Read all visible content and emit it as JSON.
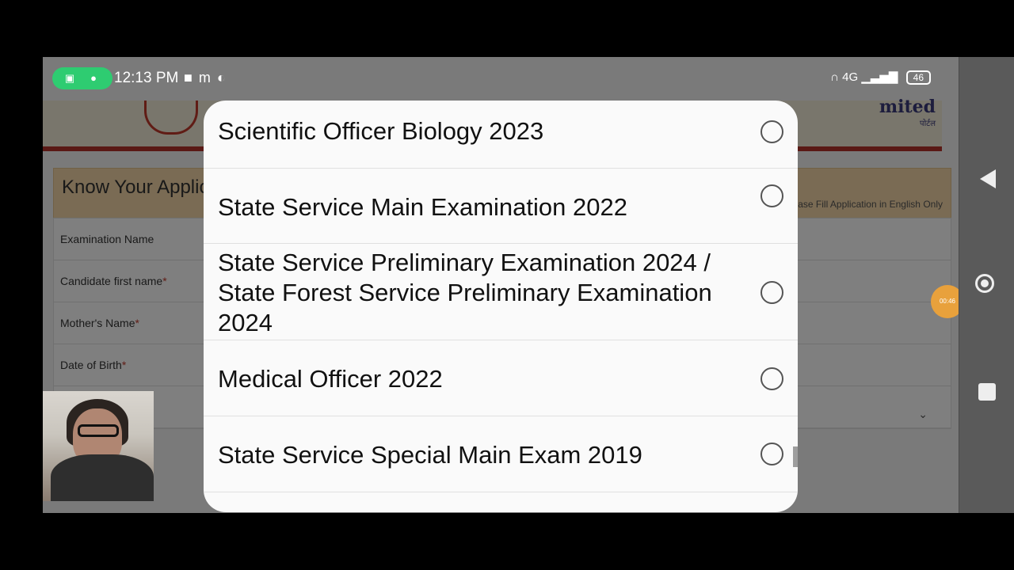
{
  "status_bar": {
    "time": "12:13 PM",
    "network": "4G",
    "battery": "46"
  },
  "page": {
    "brand_name": "mited",
    "brand_subtitle": "पोर्टल",
    "know_title": "Know Your Applic",
    "english_note": "lease Fill Application in English Only",
    "form_rows": [
      {
        "label": "Examination Name",
        "required": ""
      },
      {
        "label": "Candidate first name",
        "required": "*"
      },
      {
        "label": "Mother's Name",
        "required": "*"
      },
      {
        "label": "Date of Birth",
        "required": "*"
      }
    ],
    "timer": "00:46"
  },
  "dialog": {
    "options": [
      {
        "label": "Scientific Officer Biology 2023"
      },
      {
        "label": "State Service Main Examination 2022"
      },
      {
        "label": "State Service Preliminary Examination 2024 / State Forest Service Preliminary Examination 2024"
      },
      {
        "label": "Medical Officer 2022"
      },
      {
        "label": "State Service Special Main Exam 2019"
      }
    ]
  },
  "icons": {
    "camera": "camera-icon",
    "mic": "mic-icon",
    "back": "back-icon",
    "home": "home-icon",
    "recent": "recent-apps-icon"
  }
}
